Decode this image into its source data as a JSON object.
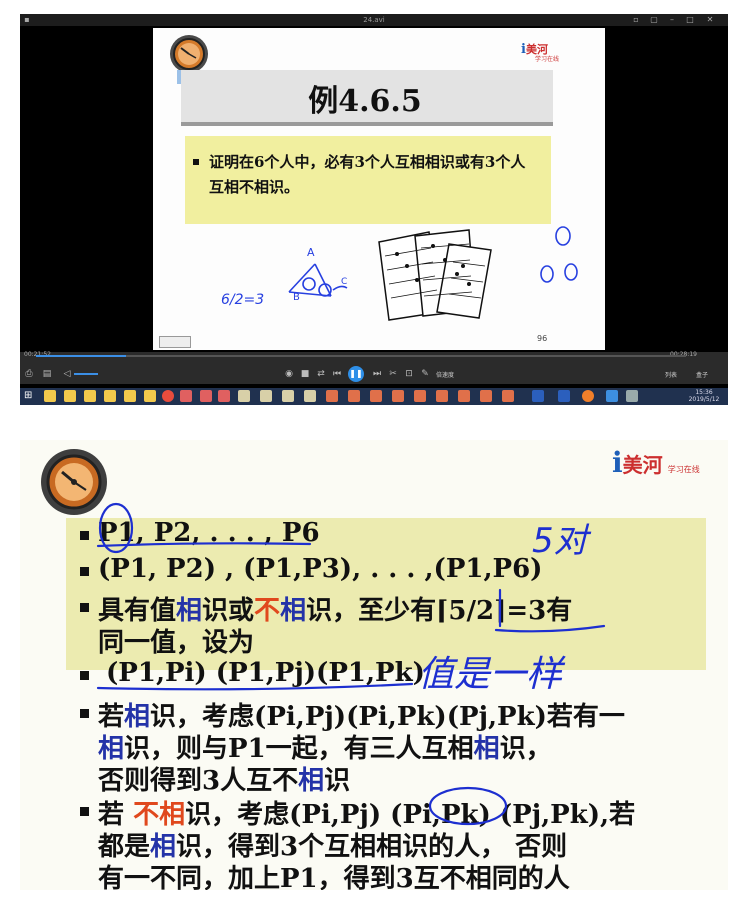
{
  "player": {
    "window_title": "24.avi",
    "time_elapsed": "00:21:52",
    "time_total": "00:28:19",
    "speed_label": "倍速度",
    "playlist_label": "列表",
    "box_label": "盒子"
  },
  "taskbar": {
    "time": "15:36",
    "date": "2019/5/12"
  },
  "slide_top": {
    "title": "例4.6.5",
    "bullet": "证明在6个人中，必有3个人互相相识或有3个人互相不相识。",
    "page_number": "96",
    "logo_text": "美河",
    "logo_sub": "学习在线",
    "handwriting": {
      "fraction": "6/2=3",
      "label_a": "A",
      "label_b": "B",
      "label_c": "C"
    }
  },
  "slide_bottom": {
    "logo_text": "美河",
    "logo_sub": "学习在线",
    "bullets": [
      "P1, P2, . . . , P6",
      "(P1, P2) , (P1,P3), . . . ,(P1,P6)",
      "具有值相识或不相识，至少有⌈5/2⌉=3有同一值，设为",
      "(P1,Pi) (P1,Pj)(P1,Pk)",
      "若相识，考虑(Pi,Pj)(Pi,Pk)(Pj,Pk)若有一相识，则与P1一起，有三人互相相识，否则得到3人互不相识",
      "若 不相识，考虑(Pi,Pj) (Pi,Pk) (Pj,Pk),若都是相识，得到3个互相相识的人， 否则有一不同，加上P1，得到3互不相同的人"
    ],
    "b3": {
      "p1": "具有值",
      "p2": "相",
      "p3": "识或",
      "p4": "不",
      "p5": "相",
      "p6": "识，至少有",
      "p7": "⌈5/2⌉",
      "p8": "=3有",
      "line2": "同一值，设为"
    },
    "b5": {
      "p1": "若",
      "p2": "相",
      "p3": "识，考虑(Pi,Pj)(Pi,Pk)(Pj,Pk)若有一",
      "line2a": "相",
      "line2b": "识，则与P1一起，有三人互相",
      "line2c": "相",
      "line2d": "识，",
      "line3a": "否则得到3人互不",
      "line3b": "相",
      "line3c": "识"
    },
    "b6": {
      "p1": "若 ",
      "p2": "不相",
      "p3": "识，考虑(Pi,Pj) (Pi,Pk) (Pj,Pk),若",
      "line2a": "都是",
      "line2b": "相",
      "line2c": "识，得到3个互相相识的人， 否则",
      "line3": "有一不同，加上P1，得到3互不相同的人"
    },
    "handwriting": {
      "five_pairs": "5对",
      "same_value": "值是一样"
    }
  },
  "colors": {
    "band_yellow": "#ecebb0",
    "title_blue": "#9cc1e8",
    "accent_blue": "#2433a8",
    "accent_red": "#e0481d",
    "ink_blue": "#1d2fd0",
    "play_blue": "#2e8fe8",
    "taskbar": "#20314f"
  }
}
